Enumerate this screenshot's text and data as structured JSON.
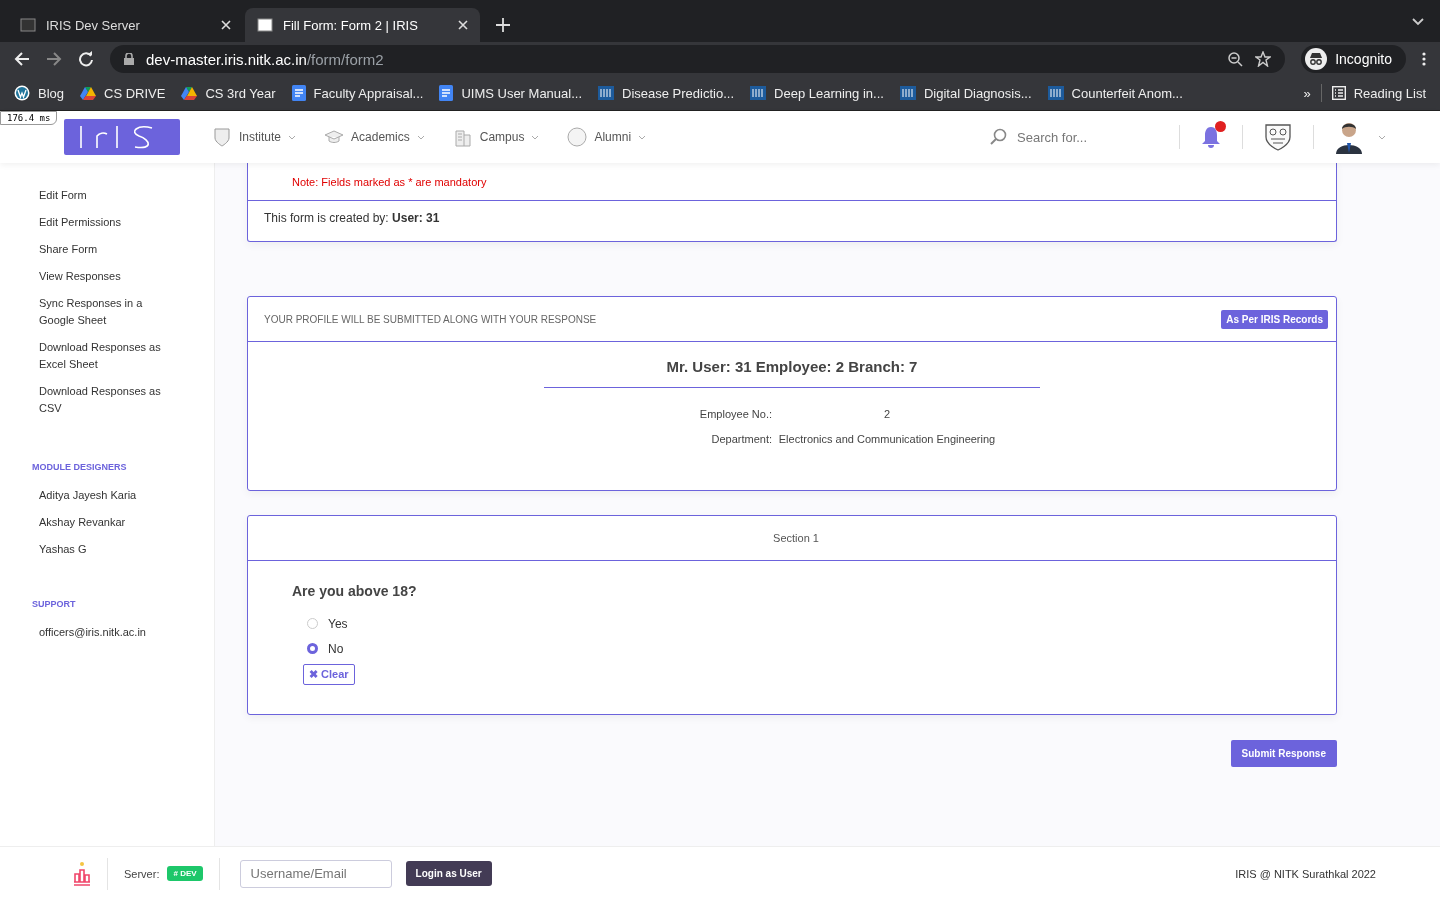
{
  "browser": {
    "tabs": [
      {
        "title": "IRIS Dev Server",
        "selected": false
      },
      {
        "title": "Fill Form: Form 2 | IRIS",
        "selected": true
      }
    ],
    "url": {
      "host": "dev-master.iris.nitk.ac.in",
      "path": "/form/form2"
    },
    "profile_label": "Incognito",
    "bookmarks": [
      {
        "label": "Blog",
        "kind": "wordpress"
      },
      {
        "label": "CS DRIVE",
        "kind": "drive"
      },
      {
        "label": "CS 3rd Year",
        "kind": "drive"
      },
      {
        "label": "Faculty Appraisal...",
        "kind": "doc"
      },
      {
        "label": "UIMS User Manual...",
        "kind": "doc"
      },
      {
        "label": "Disease Predictio...",
        "kind": "ieee"
      },
      {
        "label": "Deep Learning in...",
        "kind": "ieee"
      },
      {
        "label": "Digital Diagnosis...",
        "kind": "ieee"
      },
      {
        "label": "Counterfeit Anom...",
        "kind": "ieee"
      }
    ],
    "overflow": "»",
    "reading_list": "Reading List"
  },
  "timing_badge": "176.4 ms",
  "header": {
    "nav": [
      {
        "label": "Institute"
      },
      {
        "label": "Academics"
      },
      {
        "label": "Campus"
      },
      {
        "label": "Alumni"
      }
    ],
    "search_placeholder": "Search for...",
    "has_notification": true
  },
  "sidebar": {
    "items": [
      "Edit Form",
      "Edit Permissions",
      "Share Form",
      "View Responses",
      "Sync Responses in a Google Sheet",
      "Download Responses as Excel Sheet",
      "Download Responses as CSV"
    ],
    "sections": [
      {
        "heading": "MODULE DESIGNERS",
        "items": [
          "Aditya Jayesh Karia",
          "Akshay Revankar",
          "Yashas G"
        ]
      },
      {
        "heading": "SUPPORT",
        "items": [
          "officers@iris.nitk.ac.in"
        ]
      }
    ]
  },
  "form": {
    "note": "Note: Fields marked as * are mandatory",
    "created_by": "This form is created by: **User: 31**",
    "profile": {
      "heading": "YOUR PROFILE WILL BE SUBMITTED ALONG WITH YOUR RESPONSE",
      "badge": "As Per IRIS Records",
      "name": "Mr. User: 31 Employee: 2 Branch: 7",
      "fields": [
        {
          "label": "Employee No.:",
          "value": "2"
        },
        {
          "label": "Department:",
          "value": "Electronics and Communication Engineering"
        }
      ]
    },
    "section": {
      "title": "Section 1",
      "question": "Are you above 18?",
      "options": [
        {
          "label": "Yes",
          "selected": false
        },
        {
          "label": "No",
          "selected": true
        }
      ],
      "clear": "✖ Clear"
    },
    "submit": "Submit Response"
  },
  "footer": {
    "server_label": "Server:",
    "server_tag": "# DEV",
    "username_placeholder": "Username/Email",
    "login": "Login as User",
    "copyright": "IRIS @ NITK Surathkal 2022"
  }
}
